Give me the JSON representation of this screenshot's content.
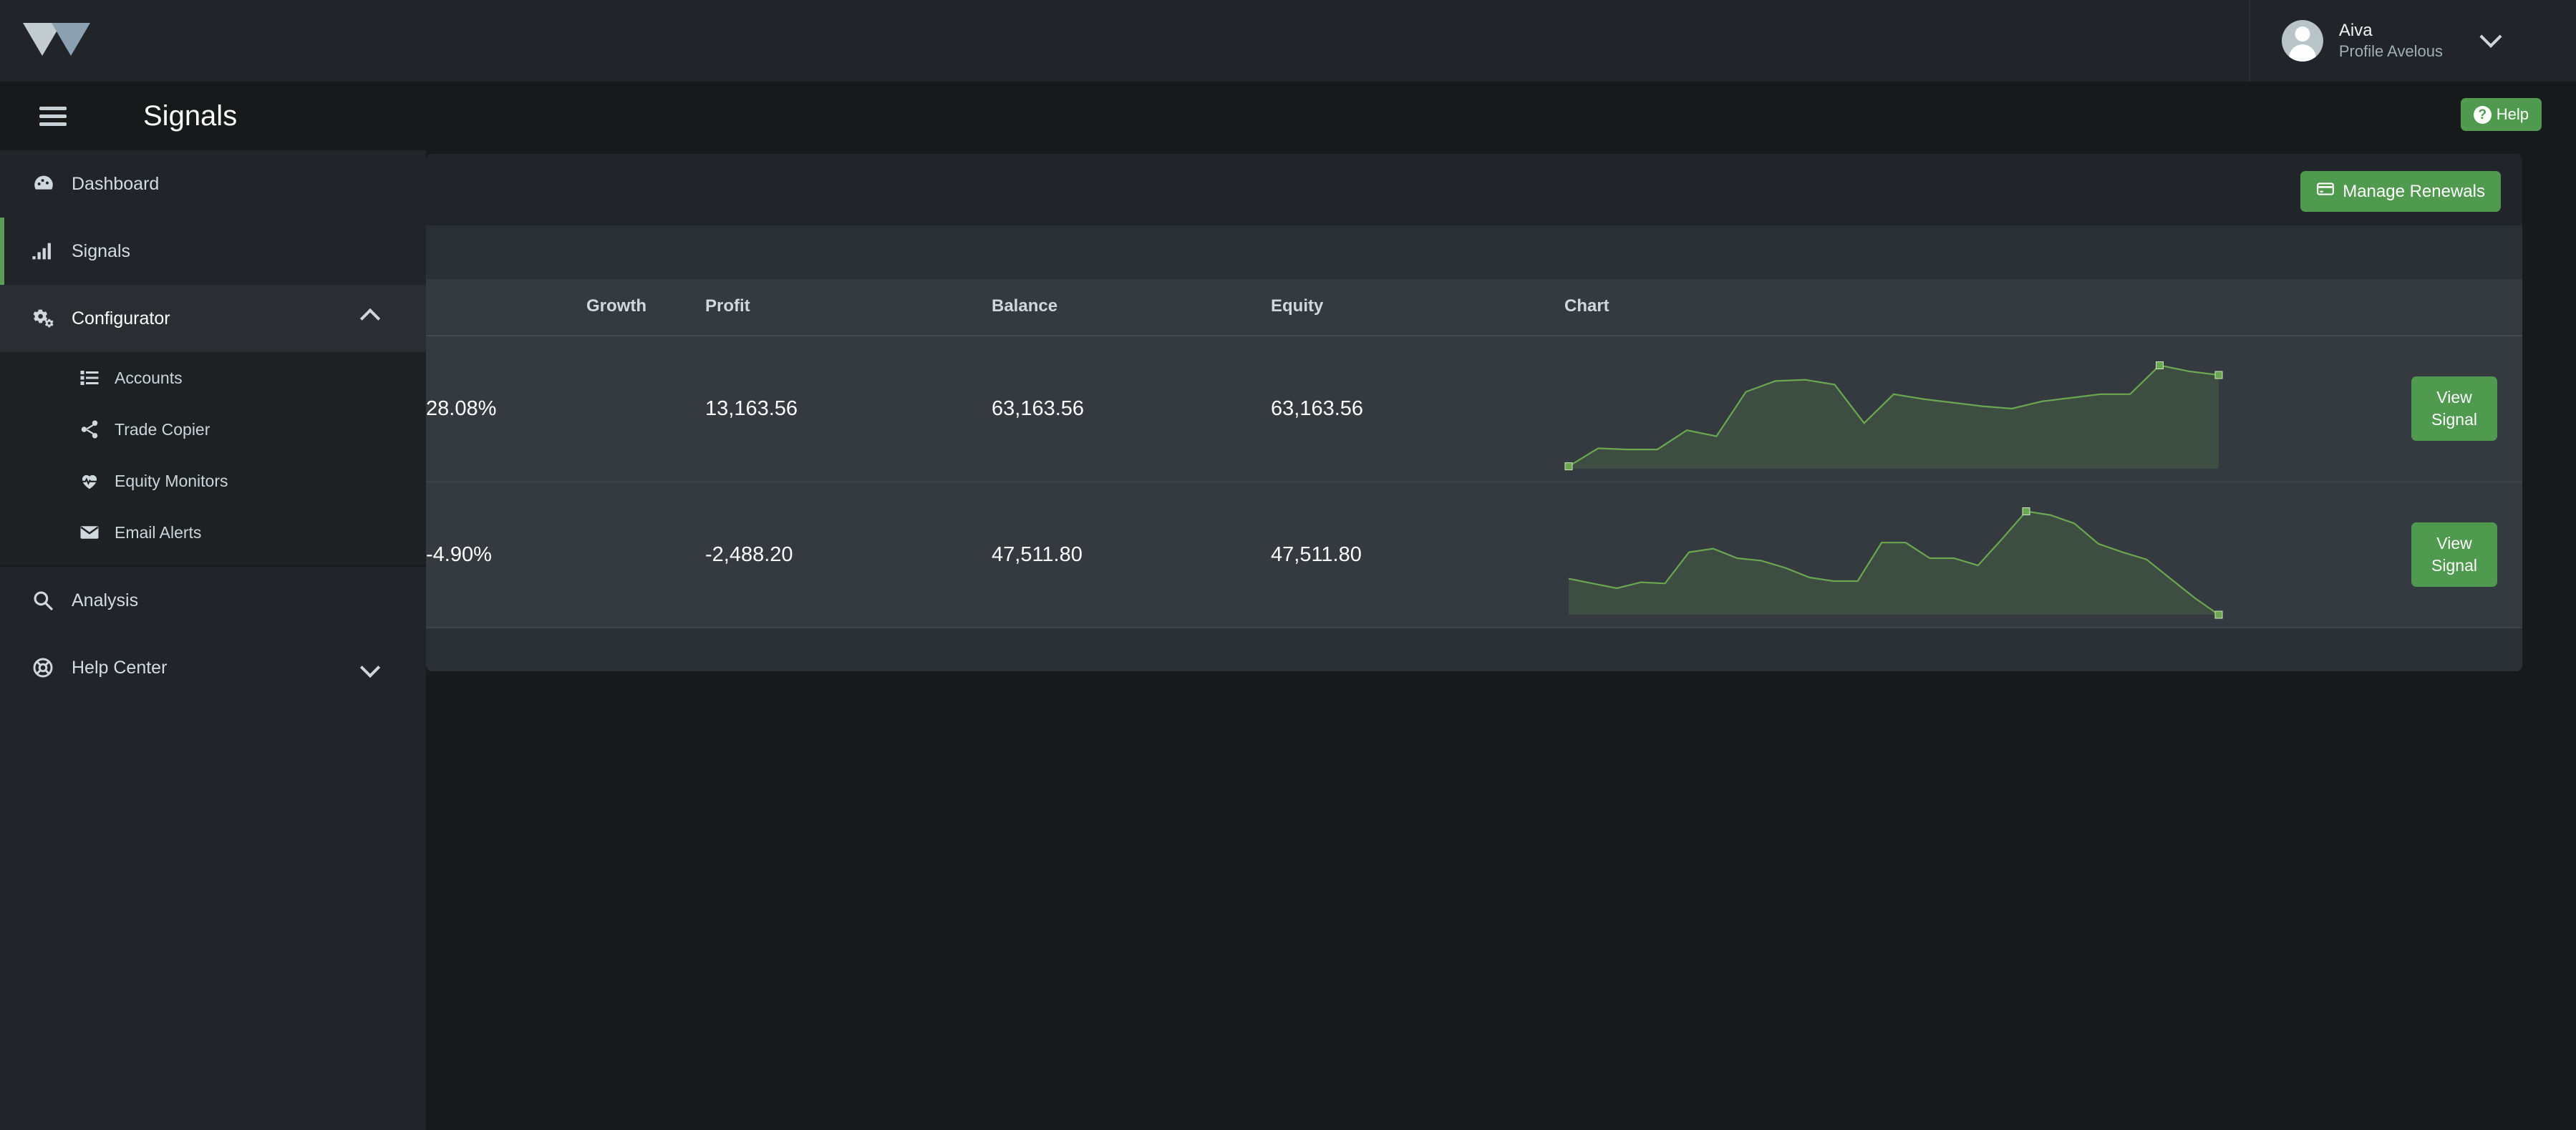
{
  "topbar": {
    "logo_name": "w-logo",
    "profile": {
      "name": "Aiva",
      "subtitle": "Profile Avelous",
      "avatar_icon": "user-avatar-icon",
      "chevron_icon": "chevron-down-icon"
    }
  },
  "header": {
    "menu_icon": "hamburger-menu-icon",
    "title": "Signals",
    "help_label": "Help",
    "help_icon": "question-circle-icon"
  },
  "sidebar": {
    "items": [
      {
        "label": "Dashboard",
        "icon": "dashboard-gauge-icon",
        "active": false
      },
      {
        "label": "Signals",
        "icon": "signal-bars-icon",
        "active": true
      },
      {
        "label": "Configurator",
        "icon": "gears-icon",
        "active": false,
        "expanded": true,
        "caret": "chevron-up-icon"
      },
      {
        "label": "Analysis",
        "icon": "search-magnifier-icon",
        "active": false
      },
      {
        "label": "Help Center",
        "icon": "lifebuoy-icon",
        "active": false,
        "expanded": false,
        "caret": "chevron-down-icon"
      }
    ],
    "submenu": [
      {
        "label": "Accounts",
        "icon": "list-icon"
      },
      {
        "label": "Trade Copier",
        "icon": "share-nodes-icon"
      },
      {
        "label": "Equity Monitors",
        "icon": "heart-pulse-icon"
      },
      {
        "label": "Email Alerts",
        "icon": "envelope-icon"
      }
    ]
  },
  "main": {
    "manage_renewals_label": "Manage Renewals",
    "manage_renewals_icon": "credit-card-icon",
    "table": {
      "columns": [
        "Growth",
        "Profit",
        "Balance",
        "Equity",
        "Chart"
      ],
      "rows": [
        {
          "growth": "28.08%",
          "profit": "13,163.56",
          "balance": "63,163.56",
          "equity": "63,163.56",
          "action_label": "View\nSignal"
        },
        {
          "growth": "-4.90%",
          "profit": "-2,488.20",
          "balance": "47,511.80",
          "equity": "47,511.80",
          "action_label": "View\nSignal"
        }
      ]
    }
  },
  "colors": {
    "accent_green": "#4f9a4f",
    "spark_line": "#6aa84f",
    "spark_fill": "rgba(106,168,79,0.18)",
    "panel_dark": "#212529",
    "panel_mid": "#2b3035",
    "row_bg": "#343a40",
    "page_bg": "#18191a"
  },
  "chart_data": [
    {
      "type": "area",
      "title": "Signal 1 balance sparkline",
      "xlabel": "",
      "ylabel": "",
      "grid": false,
      "legend": "none",
      "ylim": [
        0,
        100
      ],
      "x": [
        0,
        1,
        2,
        3,
        4,
        5,
        6,
        7,
        8,
        9,
        10,
        11,
        12,
        13,
        14,
        15,
        16,
        17,
        18,
        19,
        20,
        21,
        22
      ],
      "values": [
        2,
        17,
        16,
        16,
        32,
        27,
        64,
        73,
        74,
        70,
        38,
        62,
        58,
        55,
        52,
        50,
        56,
        59,
        62,
        62,
        86,
        81,
        78
      ],
      "markers": [
        {
          "index": 0,
          "value": 2,
          "kind": "start"
        },
        {
          "index": 20,
          "value": 86,
          "kind": "peak"
        },
        {
          "index": 22,
          "value": 78,
          "kind": "end"
        }
      ]
    },
    {
      "type": "area",
      "title": "Signal 2 balance sparkline",
      "xlabel": "",
      "ylabel": "",
      "grid": false,
      "legend": "none",
      "ylim": [
        0,
        100
      ],
      "x": [
        0,
        1,
        2,
        3,
        4,
        5,
        6,
        7,
        8,
        9,
        10,
        11,
        12,
        13,
        14,
        15,
        16,
        17,
        18,
        19,
        20,
        21,
        22,
        23
      ],
      "values": [
        30,
        26,
        22,
        27,
        26,
        52,
        55,
        47,
        45,
        39,
        31,
        28,
        28,
        60,
        60,
        47,
        47,
        41,
        63,
        86,
        83,
        76,
        59,
        52
      ],
      "markers": [
        {
          "index": 19,
          "value": 86,
          "kind": "peak"
        },
        {
          "index": 27,
          "value": 0,
          "kind": "end"
        }
      ],
      "tail": [
        {
          "index": 24,
          "value": 46
        },
        {
          "index": 25,
          "value": 30
        },
        {
          "index": 26,
          "value": 14
        },
        {
          "index": 27,
          "value": 0
        }
      ]
    }
  ]
}
